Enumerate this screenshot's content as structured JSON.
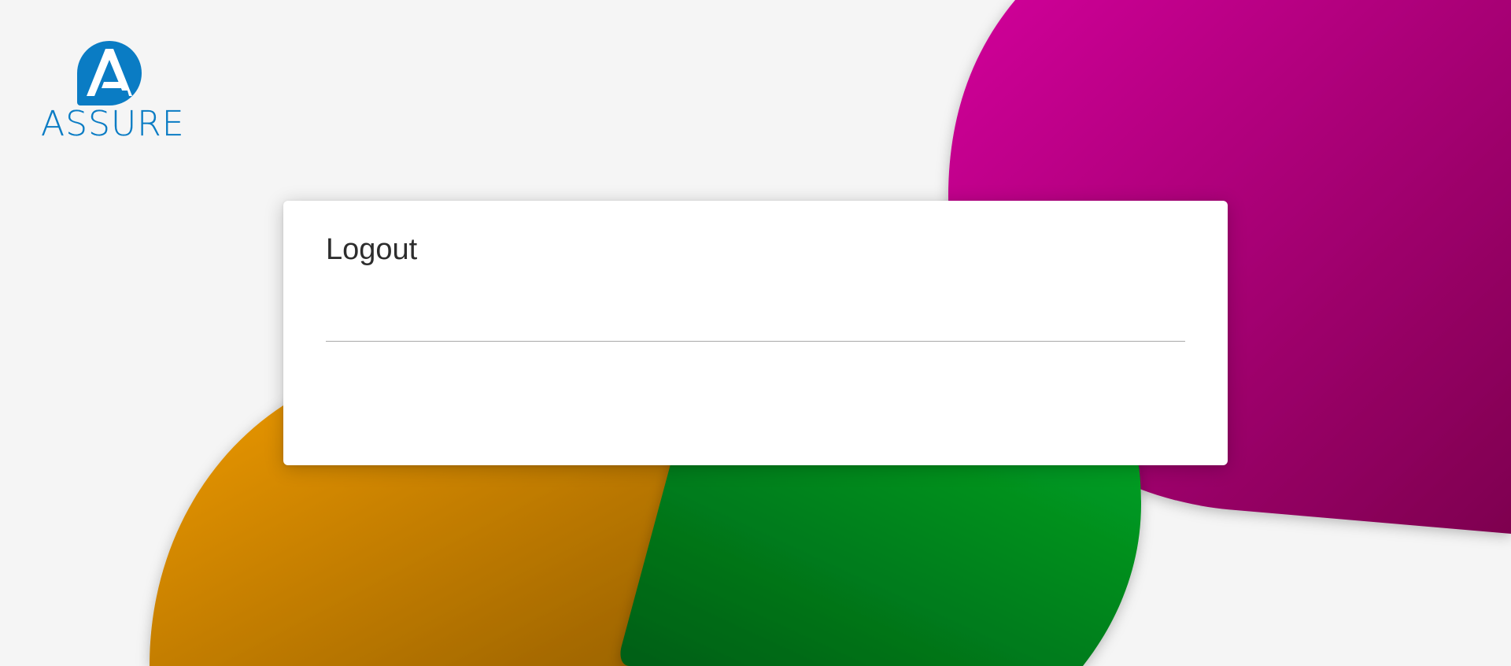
{
  "brand": {
    "name": "ASSURE",
    "primary_color": "#0a7cc4"
  },
  "card": {
    "title": "Logout"
  },
  "decor": {
    "magenta": "#c4008c",
    "orange": "#e08a00",
    "green": "#00901e"
  }
}
